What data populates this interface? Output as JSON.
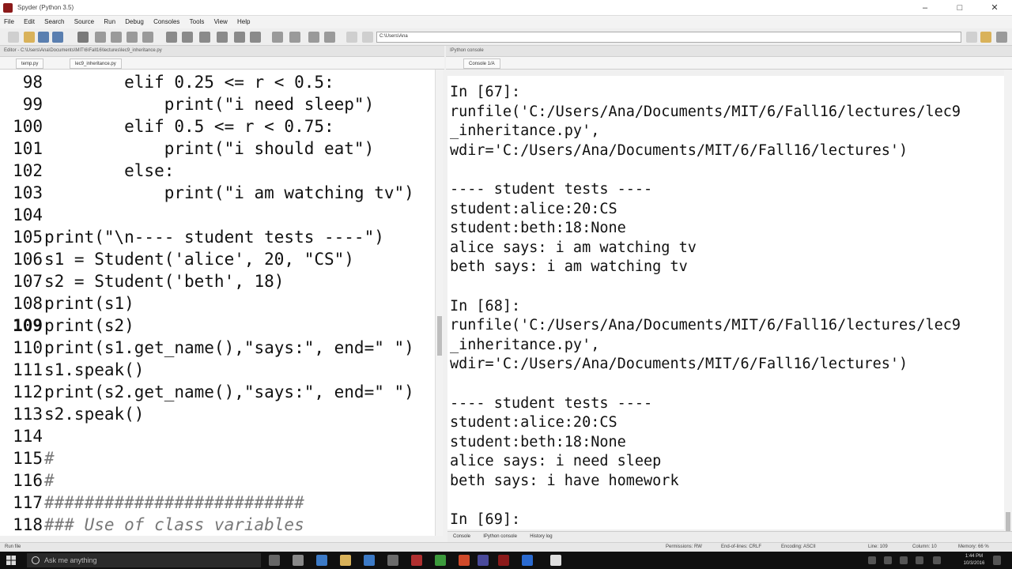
{
  "window": {
    "title": "Spyder (Python 3.5)"
  },
  "menu": [
    "File",
    "Edit",
    "Search",
    "Source",
    "Run",
    "Debug",
    "Consoles",
    "Tools",
    "View",
    "Help"
  ],
  "toolbar": {
    "path": "C:\\Users\\Ana"
  },
  "editor_pane": {
    "header": "Editor - C:\\Users\\Ana\\Documents\\MIT\\6\\Fall16\\lectures\\lec9_inheritance.py",
    "tabs": [
      "temp.py",
      "lec9_inheritance.py"
    ],
    "current_line": "109",
    "lines": [
      {
        "n": "98",
        "code": "        elif 0.25 <= r < 0.5:"
      },
      {
        "n": "99",
        "code": "            print(\"i need sleep\")"
      },
      {
        "n": "100",
        "code": "        elif 0.5 <= r < 0.75:"
      },
      {
        "n": "101",
        "code": "            print(\"i should eat\")"
      },
      {
        "n": "102",
        "code": "        else:"
      },
      {
        "n": "103",
        "code": "            print(\"i am watching tv\")"
      },
      {
        "n": "104",
        "code": ""
      },
      {
        "n": "105",
        "code": "print(\"\\n---- student tests ----\")"
      },
      {
        "n": "106",
        "code": "s1 = Student('alice', 20, \"CS\")"
      },
      {
        "n": "107",
        "code": "s2 = Student('beth', 18)"
      },
      {
        "n": "108",
        "code": "print(s1)"
      },
      {
        "n": "109",
        "code": "print(s2)"
      },
      {
        "n": "110",
        "code": "print(s1.get_name(),\"says:\", end=\" \")"
      },
      {
        "n": "111",
        "code": "s1.speak()"
      },
      {
        "n": "112",
        "code": "print(s2.get_name(),\"says:\", end=\" \")"
      },
      {
        "n": "113",
        "code": "s2.speak()"
      },
      {
        "n": "114",
        "code": ""
      },
      {
        "n": "115",
        "code": "#"
      },
      {
        "n": "116",
        "code": "#"
      },
      {
        "n": "117",
        "code": "##########################"
      },
      {
        "n": "118",
        "code": "### Use of class variables"
      }
    ]
  },
  "console_pane": {
    "header": "IPython console",
    "tabs": [
      "Console 1/A"
    ],
    "lines": [
      "In [67]:",
      "runfile('C:/Users/Ana/Documents/MIT/6/Fall16/lectures/lec9",
      "_inheritance.py',",
      "wdir='C:/Users/Ana/Documents/MIT/6/Fall16/lectures')",
      "",
      "---- student tests ----",
      "student:alice:20:CS",
      "student:beth:18:None",
      "alice says: i am watching tv",
      "beth says: i am watching tv",
      "",
      "In [68]:",
      "runfile('C:/Users/Ana/Documents/MIT/6/Fall16/lectures/lec9",
      "_inheritance.py',",
      "wdir='C:/Users/Ana/Documents/MIT/6/Fall16/lectures')",
      "",
      "---- student tests ----",
      "student:alice:20:CS",
      "student:beth:18:None",
      "alice says: i need sleep",
      "beth says: i have homework",
      "",
      "In [69]:"
    ],
    "bottom_tabs": [
      "Console",
      "IPython console",
      "History log"
    ]
  },
  "statusbar": {
    "left": "Run file",
    "permissions": "Permissions: RW",
    "eol": "End-of-lines: CRLF",
    "encoding": "Encoding: ASCII",
    "line": "Line: 109",
    "column": "Column: 10",
    "memory": "Memory: 66 %"
  },
  "taskbar": {
    "search_placeholder": "Ask me anything",
    "time": "1:44 PM",
    "date": "10/3/2016"
  }
}
